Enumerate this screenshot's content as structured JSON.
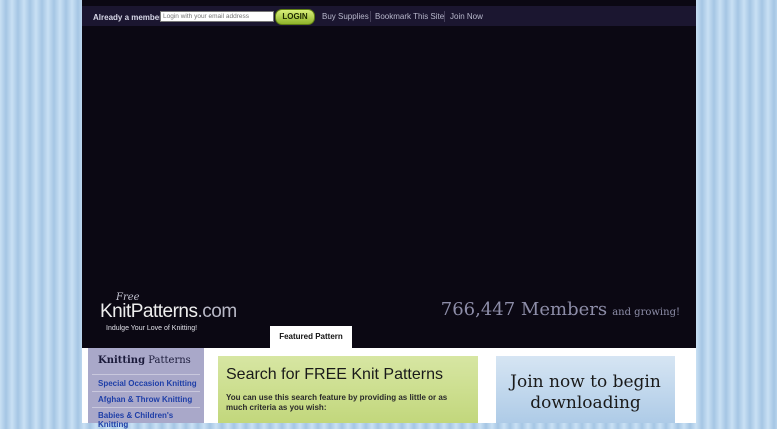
{
  "topbar": {
    "member_prompt": "Already a member?",
    "email_placeholder": "Login with your email address",
    "login_label": "LOGIN",
    "links": [
      "Buy Supplies",
      "Bookmark This Site",
      "Join Now"
    ]
  },
  "logo": {
    "free": "Free",
    "name": "KnitPatterns",
    "domain": ".com",
    "tagline": "Indulge Your Love of Knitting!"
  },
  "members": {
    "count": "766,447 Members",
    "suffix": "and growing!"
  },
  "featured_tab": "Featured Pattern",
  "sidebar": {
    "heading_bold": "Knitting",
    "heading_rest": " Patterns",
    "items": [
      "Special Occasion Knitting",
      "Afghan & Throw Knitting",
      "Babies & Children's Knitting"
    ]
  },
  "search": {
    "heading": "Search for FREE Knit Patterns",
    "text": "You can use this search feature by providing as little or as much criteria as you wish:"
  },
  "join": {
    "heading_line1": "Join now to begin",
    "heading_line2": "downloading"
  },
  "colors": {
    "header_bg": "#0b0813",
    "login_green": "#b5d144",
    "link_blue": "#1f3fa8",
    "search_green": "#ccdd8f",
    "join_blue": "#c2d8ee"
  }
}
